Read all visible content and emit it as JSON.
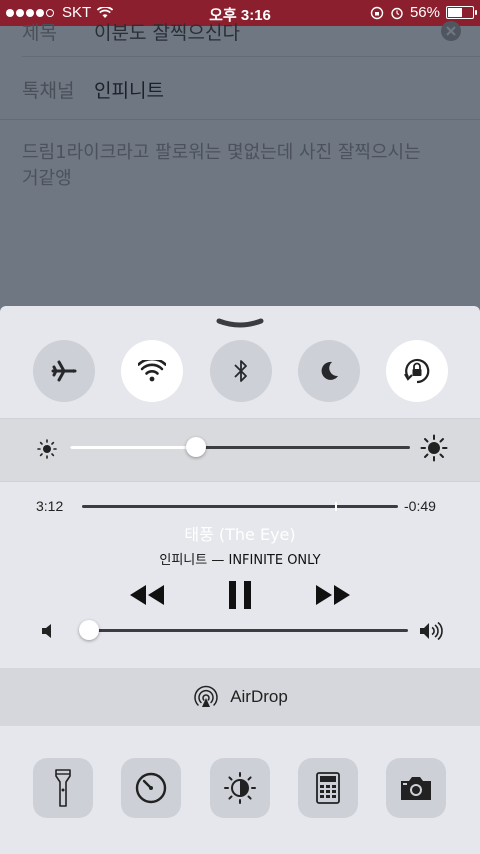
{
  "status_bar": {
    "carrier": "SKT",
    "time": "오후 3:16",
    "battery_percent": "56%",
    "signal_bars_filled": 4,
    "signal_bars_total": 5
  },
  "background_app": {
    "title_label": "제목",
    "title_value": "이분도 잘찍으신다",
    "channel_label": "톡채널",
    "channel_value": "인피니트",
    "body_text_line1": "드림1라이크라고 팔로워는 몇없는데 사진 잘찍으시는",
    "body_text_line2": "거같앵"
  },
  "control_center": {
    "toggles": [
      {
        "name": "airplane-mode",
        "icon": "airplane-icon",
        "on": false
      },
      {
        "name": "wifi",
        "icon": "wifi-icon",
        "on": true
      },
      {
        "name": "bluetooth",
        "icon": "bluetooth-icon",
        "on": false
      },
      {
        "name": "do-not-disturb",
        "icon": "moon-icon",
        "on": false
      },
      {
        "name": "rotation-lock",
        "icon": "rotation-lock-icon",
        "on": true
      }
    ],
    "brightness_level": 0.37,
    "music": {
      "elapsed": "3:12",
      "remaining": "-0:49",
      "progress": 0.8,
      "title": "태풍 (The Eye)",
      "artist_album": "인피니트 — INFINITE ONLY",
      "volume_level": 0.02
    },
    "airdrop_label": "AirDrop",
    "tools": [
      {
        "name": "flashlight",
        "icon": "flashlight-icon"
      },
      {
        "name": "timer",
        "icon": "timer-icon"
      },
      {
        "name": "night-shift",
        "icon": "night-shift-icon"
      },
      {
        "name": "calculator",
        "icon": "calculator-icon"
      },
      {
        "name": "camera",
        "icon": "camera-icon"
      }
    ]
  }
}
